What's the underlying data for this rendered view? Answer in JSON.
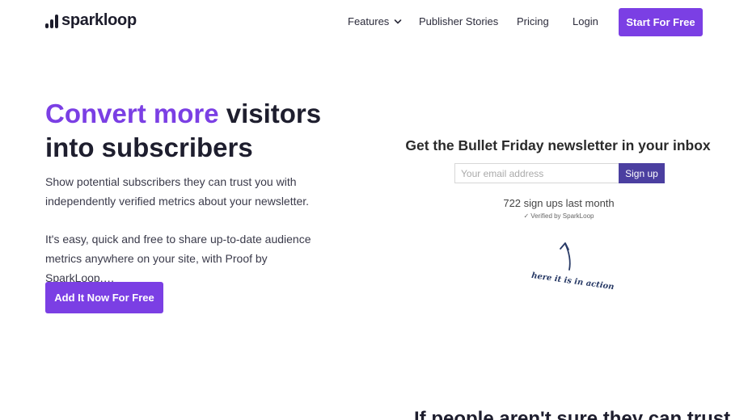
{
  "nav": {
    "logo_text": "sparkloop",
    "items": [
      {
        "label": "Features",
        "has_dropdown": true
      },
      {
        "label": "Publisher Stories"
      },
      {
        "label": "Pricing"
      },
      {
        "label": "Login"
      }
    ],
    "cta": "Start For Free"
  },
  "hero": {
    "title_accent": "Convert more",
    "title_rest": " visitors into subscribers",
    "paragraph1": "Show potential subscribers they can trust you with independently verified metrics about your newsletter.",
    "paragraph2": "It's easy, quick and free to share up-to-date audience metrics anywhere on your site, with Proof by SparkLoop.…",
    "cta": "Add It Now For Free"
  },
  "widget": {
    "title": "Get the Bullet Friday newsletter in your inbox",
    "email_placeholder": "Your email address",
    "signup_label": "Sign up",
    "stat": "722 sign ups last month",
    "verified": "Verified by SparkLoop",
    "annotation": "here it is in action"
  },
  "section2": {
    "heading_partial": "If people aren't sure they can trust"
  },
  "colors": {
    "accent": "#7b3fe4",
    "signup_button": "#4b3fa0",
    "text_dark": "#1e1e2e"
  },
  "icons": [
    "sparkloop-logo-icon",
    "chevron-down-icon",
    "check-icon",
    "arrow-icon"
  ]
}
